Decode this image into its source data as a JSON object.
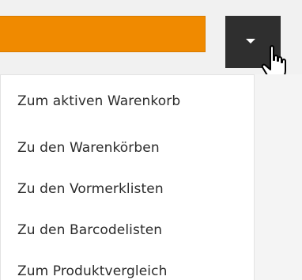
{
  "toolbar": {
    "accent_color": "#f08a00",
    "toggle_color": "#2f2f2f",
    "caret_icon": "caret-down-icon",
    "cursor_icon": "hand-pointer-icon"
  },
  "menu": {
    "items": [
      {
        "label": "Zum aktiven Warenkorb"
      },
      {
        "label": "Zu den Warenkörben"
      },
      {
        "label": "Zu den Vormerklisten"
      },
      {
        "label": "Zu den Barcodelisten"
      },
      {
        "label": "Zum Produktvergleich"
      }
    ]
  }
}
